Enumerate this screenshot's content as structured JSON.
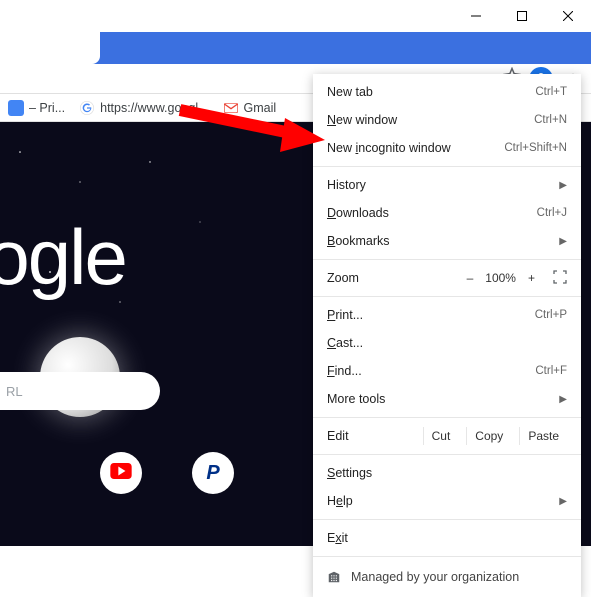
{
  "titlebar": {
    "minimize": "–",
    "maximize": "▢",
    "close": "✕"
  },
  "bookmarks": {
    "pri_label": "– Pri...",
    "google_label": "https://www.googl...",
    "gmail_label": "Gmail"
  },
  "content": {
    "logo_text": "oogle",
    "search_placeholder": "RL"
  },
  "menu": {
    "new_tab": "New tab",
    "new_tab_key": "Ctrl+T",
    "new_window": "New window",
    "new_window_u": "N",
    "new_window_key": "Ctrl+N",
    "incognito": "New incognito window",
    "incognito_u": "i",
    "incognito_key": "Ctrl+Shift+N",
    "history": "History",
    "downloads": "Downloads",
    "downloads_u": "D",
    "downloads_key": "Ctrl+J",
    "bookmarks": "Bookmarks",
    "bookmarks_u": "B",
    "zoom_label": "Zoom",
    "zoom_minus": "–",
    "zoom_value": "100%",
    "zoom_plus": "+",
    "print": "Print...",
    "print_u": "P",
    "print_key": "Ctrl+P",
    "cast": "Cast...",
    "cast_u": "C",
    "find": "Find...",
    "find_u": "F",
    "find_key": "Ctrl+F",
    "more_tools": "More tools",
    "edit_label": "Edit",
    "cut": "Cut",
    "copy": "Copy",
    "paste": "Paste",
    "settings": "Settings",
    "settings_u": "S",
    "help": "Help",
    "help_u": "e",
    "exit": "Exit",
    "exit_u": "x",
    "managed": "Managed by your organization"
  }
}
